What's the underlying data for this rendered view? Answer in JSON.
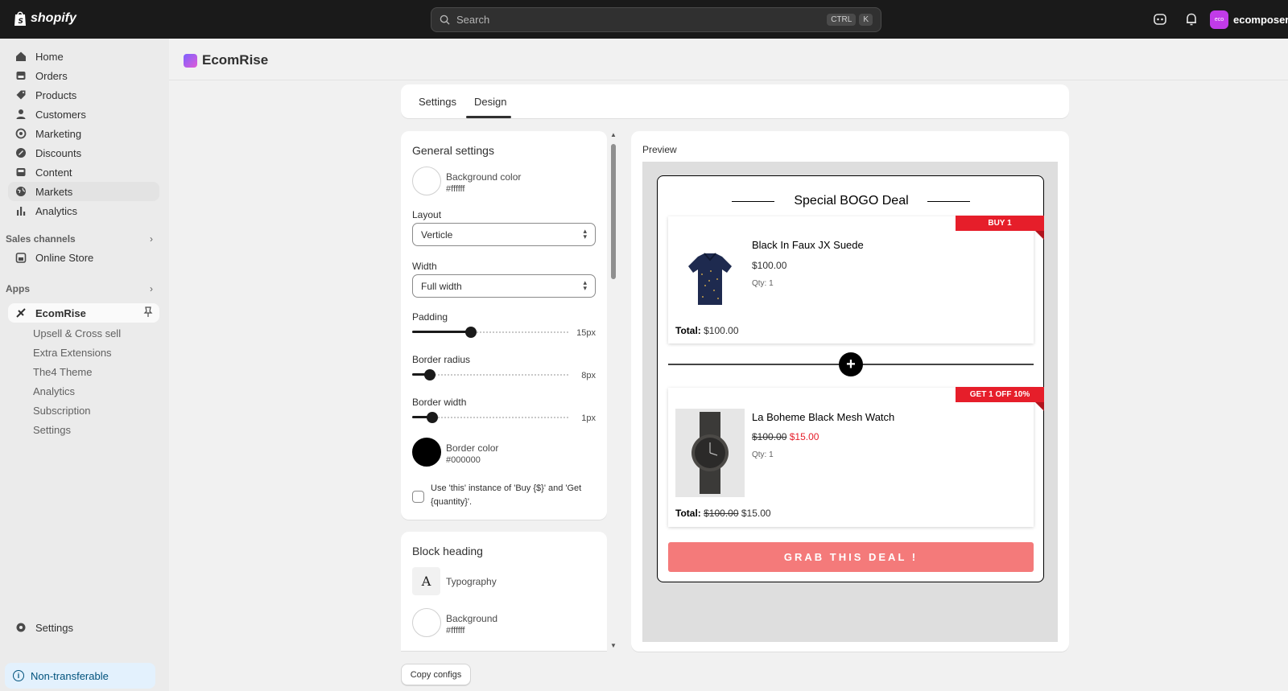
{
  "topbar": {
    "brand": "shopify",
    "search_placeholder": "Search",
    "kbd_ctrl": "CTRL",
    "kbd_k": "K",
    "store_name": "ecomposer-ra",
    "store_avatar": "eco"
  },
  "sidebar": {
    "items": [
      {
        "label": "Home",
        "icon": "home-icon"
      },
      {
        "label": "Orders",
        "icon": "orders-icon"
      },
      {
        "label": "Products",
        "icon": "tag-icon"
      },
      {
        "label": "Customers",
        "icon": "person-icon"
      },
      {
        "label": "Marketing",
        "icon": "target-icon"
      },
      {
        "label": "Discounts",
        "icon": "discount-icon"
      },
      {
        "label": "Content",
        "icon": "content-icon"
      },
      {
        "label": "Markets",
        "icon": "globe-icon"
      },
      {
        "label": "Analytics",
        "icon": "bar-chart-icon"
      }
    ],
    "sales_channels_title": "Sales channels",
    "online_store": "Online Store",
    "apps_title": "Apps",
    "app_name": "EcomRise",
    "app_subitems": [
      "Upsell & Cross sell",
      "Extra Extensions",
      "The4 Theme",
      "Analytics",
      "Subscription",
      "Settings"
    ],
    "settings": "Settings",
    "non_transferable": "Non-transferable"
  },
  "app_header": {
    "title": "EcomRise"
  },
  "tabs": [
    {
      "label": "Settings"
    },
    {
      "label": "Design",
      "active": true
    }
  ],
  "general": {
    "title": "General settings",
    "bg_label": "Background color",
    "bg_value": "#ffffff",
    "layout_label": "Layout",
    "layout_value": "Verticle",
    "width_label": "Width",
    "width_value": "Full width",
    "padding_label": "Padding",
    "padding_value": "15px",
    "padding_fraction": 0.37,
    "radius_label": "Border radius",
    "radius_value": "8px",
    "radius_fraction": 0.11,
    "bwidth_label": "Border width",
    "bwidth_value": "1px",
    "bwidth_fraction": 0.13,
    "bcolor_label": "Border color",
    "bcolor_value": "#000000",
    "checkbox_label": "Use 'this' instance of 'Buy {$}' and 'Get {quantity}'."
  },
  "block_heading": {
    "title": "Block heading",
    "typography_label": "Typography",
    "typography_glyph": "A",
    "bg_label": "Background",
    "bg_value": "#ffffff"
  },
  "copy_configs": "Copy configs",
  "preview": {
    "label": "Preview",
    "title": "Special BOGO Deal",
    "items": [
      {
        "badge": "BUY 1",
        "name": "Black In Faux JX Suede",
        "price": "$100.00",
        "qty": "Qty: 1",
        "total_label": "Total:",
        "total": "$100.00"
      },
      {
        "badge": "GET 1 OFF 10%",
        "name": "La Boheme Black Mesh Watch",
        "old_price": "$100.00",
        "sale_price": "$15.00",
        "qty": "Qty: 1",
        "total_label": "Total:",
        "total_old": "$100.00",
        "total_sale": "$15.00"
      }
    ],
    "cta": "GRAB THIS DEAL !"
  },
  "colors": {
    "topbar": "#1a1a1a",
    "badge": "#e61e2a",
    "cta": "#f47a7a",
    "sale": "#e61e2a",
    "store_avatar": "#c13be8"
  }
}
